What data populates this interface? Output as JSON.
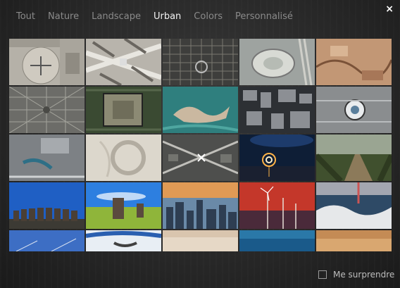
{
  "tabs": [
    {
      "label": "Tout",
      "active": false
    },
    {
      "label": "Nature",
      "active": false
    },
    {
      "label": "Landscape",
      "active": false
    },
    {
      "label": "Urban",
      "active": true
    },
    {
      "label": "Colors",
      "active": false
    },
    {
      "label": "Personnalisé",
      "active": false
    }
  ],
  "close_label": "×",
  "footer": {
    "surprise_label": "Me surprendre",
    "checked": false
  },
  "accent": "#f2f2f2"
}
